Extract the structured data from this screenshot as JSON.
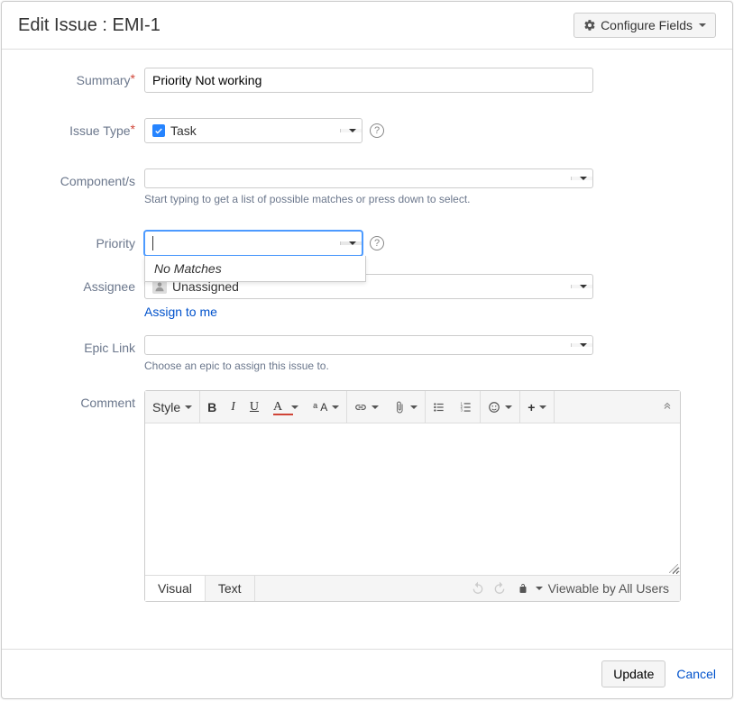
{
  "header": {
    "title": "Edit Issue : EMI-1",
    "configure_label": "Configure Fields"
  },
  "fields": {
    "summary": {
      "label": "Summary",
      "value": "Priority Not working"
    },
    "issue_type": {
      "label": "Issue Type",
      "value": "Task"
    },
    "components": {
      "label": "Component/s",
      "value": "",
      "hint": "Start typing to get a list of possible matches or press down to select."
    },
    "priority": {
      "label": "Priority",
      "value": "",
      "no_matches": "No Matches"
    },
    "assignee": {
      "label": "Assignee",
      "value": "Unassigned",
      "assign_to_me": "Assign to me"
    },
    "epic_link": {
      "label": "Epic Link",
      "value": "",
      "hint": "Choose an epic to assign this issue to."
    },
    "comment": {
      "label": "Comment",
      "style_label": "Style",
      "visual_tab": "Visual",
      "text_tab": "Text",
      "permission": "Viewable by All Users"
    }
  },
  "footer": {
    "update": "Update",
    "cancel": "Cancel"
  }
}
